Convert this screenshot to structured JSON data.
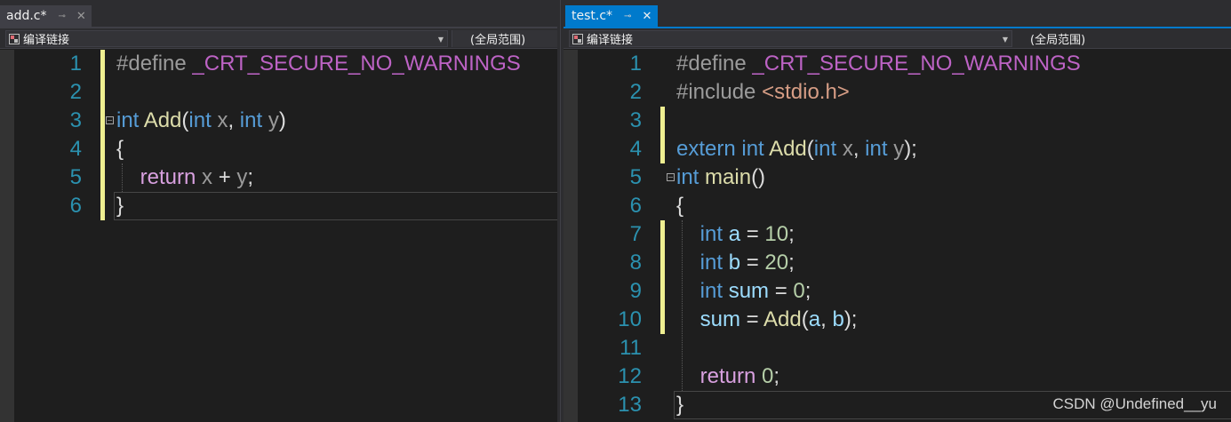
{
  "left_pane": {
    "tab": {
      "label": "add.c*",
      "pin_icon": "pin-icon",
      "close_icon": "close-icon"
    },
    "nav": {
      "scope_dropdown": "编译链接",
      "member_dropdown": "(全局范围)"
    },
    "lines": [
      {
        "num": "1",
        "changed": true,
        "fold": false,
        "tokens": [
          [
            "pp",
            "#define "
          ],
          [
            "mac",
            "_CRT_SECURE_NO_WARNINGS"
          ]
        ]
      },
      {
        "num": "2",
        "changed": true,
        "fold": false,
        "tokens": []
      },
      {
        "num": "3",
        "changed": true,
        "fold": true,
        "tokens": [
          [
            "kw",
            "int"
          ],
          [
            "pl",
            " "
          ],
          [
            "fn",
            "Add"
          ],
          [
            "pl",
            "("
          ],
          [
            "kw",
            "int"
          ],
          [
            "pl",
            " "
          ],
          [
            "prm",
            "x"
          ],
          [
            "pl",
            ", "
          ],
          [
            "kw",
            "int"
          ],
          [
            "pl",
            " "
          ],
          [
            "prm",
            "y"
          ],
          [
            "pl",
            ")"
          ]
        ]
      },
      {
        "num": "4",
        "changed": true,
        "fold": false,
        "tokens": [
          [
            "pl",
            "{"
          ]
        ]
      },
      {
        "num": "5",
        "changed": true,
        "fold": false,
        "tokens": [
          [
            "pl",
            "    "
          ],
          [
            "kwc",
            "return"
          ],
          [
            "pl",
            " "
          ],
          [
            "prm",
            "x"
          ],
          [
            "pl",
            " + "
          ],
          [
            "prm",
            "y"
          ],
          [
            "pl",
            ";"
          ]
        ]
      },
      {
        "num": "6",
        "changed": true,
        "fold": false,
        "tokens": [
          [
            "pl",
            "}"
          ]
        ]
      }
    ]
  },
  "right_pane": {
    "tab": {
      "label": "test.c*",
      "pin_icon": "pin-icon",
      "close_icon": "close-icon"
    },
    "nav": {
      "scope_dropdown": "编译链接",
      "member_dropdown": "(全局范围)"
    },
    "lines": [
      {
        "num": "1",
        "changed": false,
        "fold": false,
        "tokens": [
          [
            "pp",
            "#define "
          ],
          [
            "mac",
            "_CRT_SECURE_NO_WARNINGS"
          ]
        ]
      },
      {
        "num": "2",
        "changed": false,
        "fold": false,
        "tokens": [
          [
            "pp",
            "#include "
          ],
          [
            "str",
            "<stdio.h>"
          ]
        ]
      },
      {
        "num": "3",
        "changed": true,
        "fold": false,
        "tokens": []
      },
      {
        "num": "4",
        "changed": true,
        "fold": false,
        "tokens": [
          [
            "kw",
            "extern"
          ],
          [
            "pl",
            " "
          ],
          [
            "kw",
            "int"
          ],
          [
            "pl",
            " "
          ],
          [
            "fn",
            "Add"
          ],
          [
            "pl",
            "("
          ],
          [
            "kw",
            "int"
          ],
          [
            "pl",
            " "
          ],
          [
            "prm",
            "x"
          ],
          [
            "pl",
            ", "
          ],
          [
            "kw",
            "int"
          ],
          [
            "pl",
            " "
          ],
          [
            "prm",
            "y"
          ],
          [
            "pl",
            ");"
          ]
        ]
      },
      {
        "num": "5",
        "changed": false,
        "fold": true,
        "tokens": [
          [
            "kw",
            "int"
          ],
          [
            "pl",
            " "
          ],
          [
            "fn",
            "main"
          ],
          [
            "pl",
            "()"
          ]
        ]
      },
      {
        "num": "6",
        "changed": false,
        "fold": false,
        "tokens": [
          [
            "pl",
            "{"
          ]
        ]
      },
      {
        "num": "7",
        "changed": true,
        "fold": false,
        "tokens": [
          [
            "pl",
            "    "
          ],
          [
            "kw",
            "int"
          ],
          [
            "pl",
            " "
          ],
          [
            "var",
            "a"
          ],
          [
            "pl",
            " = "
          ],
          [
            "num",
            "10"
          ],
          [
            "pl",
            ";"
          ]
        ]
      },
      {
        "num": "8",
        "changed": true,
        "fold": false,
        "tokens": [
          [
            "pl",
            "    "
          ],
          [
            "kw",
            "int"
          ],
          [
            "pl",
            " "
          ],
          [
            "var",
            "b"
          ],
          [
            "pl",
            " = "
          ],
          [
            "num",
            "20"
          ],
          [
            "pl",
            ";"
          ]
        ]
      },
      {
        "num": "9",
        "changed": true,
        "fold": false,
        "tokens": [
          [
            "pl",
            "    "
          ],
          [
            "kw",
            "int"
          ],
          [
            "pl",
            " "
          ],
          [
            "var",
            "sum"
          ],
          [
            "pl",
            " = "
          ],
          [
            "num",
            "0"
          ],
          [
            "pl",
            ";"
          ]
        ]
      },
      {
        "num": "10",
        "changed": true,
        "fold": false,
        "tokens": [
          [
            "pl",
            "    "
          ],
          [
            "var",
            "sum"
          ],
          [
            "pl",
            " = "
          ],
          [
            "fn",
            "Add"
          ],
          [
            "pl",
            "("
          ],
          [
            "var",
            "a"
          ],
          [
            "pl",
            ", "
          ],
          [
            "var",
            "b"
          ],
          [
            "pl",
            ");"
          ]
        ]
      },
      {
        "num": "11",
        "changed": false,
        "fold": false,
        "tokens": []
      },
      {
        "num": "12",
        "changed": false,
        "fold": false,
        "tokens": [
          [
            "pl",
            "    "
          ],
          [
            "kwc",
            "return"
          ],
          [
            "pl",
            " "
          ],
          [
            "num",
            "0"
          ],
          [
            "pl",
            ";"
          ]
        ]
      },
      {
        "num": "13",
        "changed": false,
        "fold": false,
        "tokens": [
          [
            "pl",
            "}"
          ]
        ]
      }
    ]
  },
  "watermark": "CSDN @Undefined__yu",
  "colors": {
    "editor_bg": "#1e1e1e",
    "active_tab": "#007acc",
    "line_number": "#2b91af",
    "keyword": "#569cd6",
    "control_keyword": "#d8a0df",
    "function": "#dcdcaa",
    "change_marker": "#efef91"
  }
}
